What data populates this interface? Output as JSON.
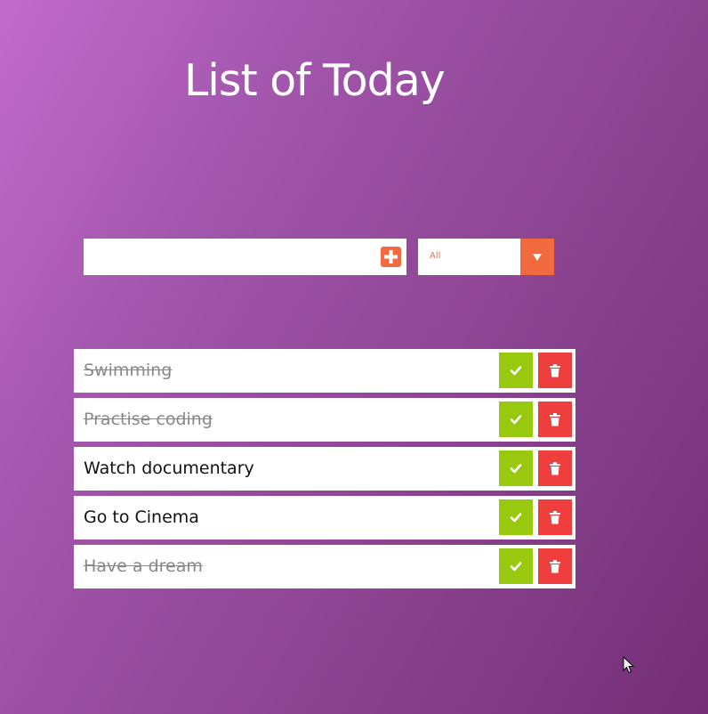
{
  "header": {
    "title": "List of Today"
  },
  "form": {
    "input_value": "",
    "input_placeholder": "",
    "add_icon": "plus-icon",
    "filter_selected": "All",
    "filter_icon": "caret-down-icon"
  },
  "todos": [
    {
      "text": "Swimming",
      "completed": true
    },
    {
      "text": "Practise coding",
      "completed": true
    },
    {
      "text": "Watch documentary",
      "completed": false
    },
    {
      "text": "Go to Cinema",
      "completed": false
    },
    {
      "text": "Have a dream",
      "completed": true
    }
  ],
  "icons": {
    "complete": "check-icon",
    "delete": "trash-icon"
  },
  "colors": {
    "accent": "#f26a3f",
    "complete": "#98c90f",
    "delete": "#ef3e3e",
    "background_start": "#c26bcc",
    "background_end": "#742f76"
  }
}
